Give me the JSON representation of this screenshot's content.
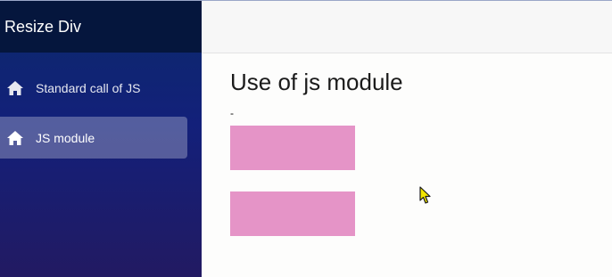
{
  "app": {
    "title": "Resize Div"
  },
  "sidebar": {
    "items": [
      {
        "label": "Standard call of JS",
        "icon": "home-icon",
        "active": false
      },
      {
        "label": "JS module",
        "icon": "home-icon",
        "active": true
      }
    ]
  },
  "main": {
    "title": "Use of js module",
    "dash": "-",
    "boxes": [
      {
        "color": "#e594c7"
      },
      {
        "color": "#e594c7"
      }
    ]
  },
  "colors": {
    "sidebar_top": "#05163d",
    "sidebar_gradient_start": "#0b2a6b",
    "sidebar_gradient_end": "#221a62",
    "box": "#e594c7",
    "topbar": "#f7f7f7"
  }
}
